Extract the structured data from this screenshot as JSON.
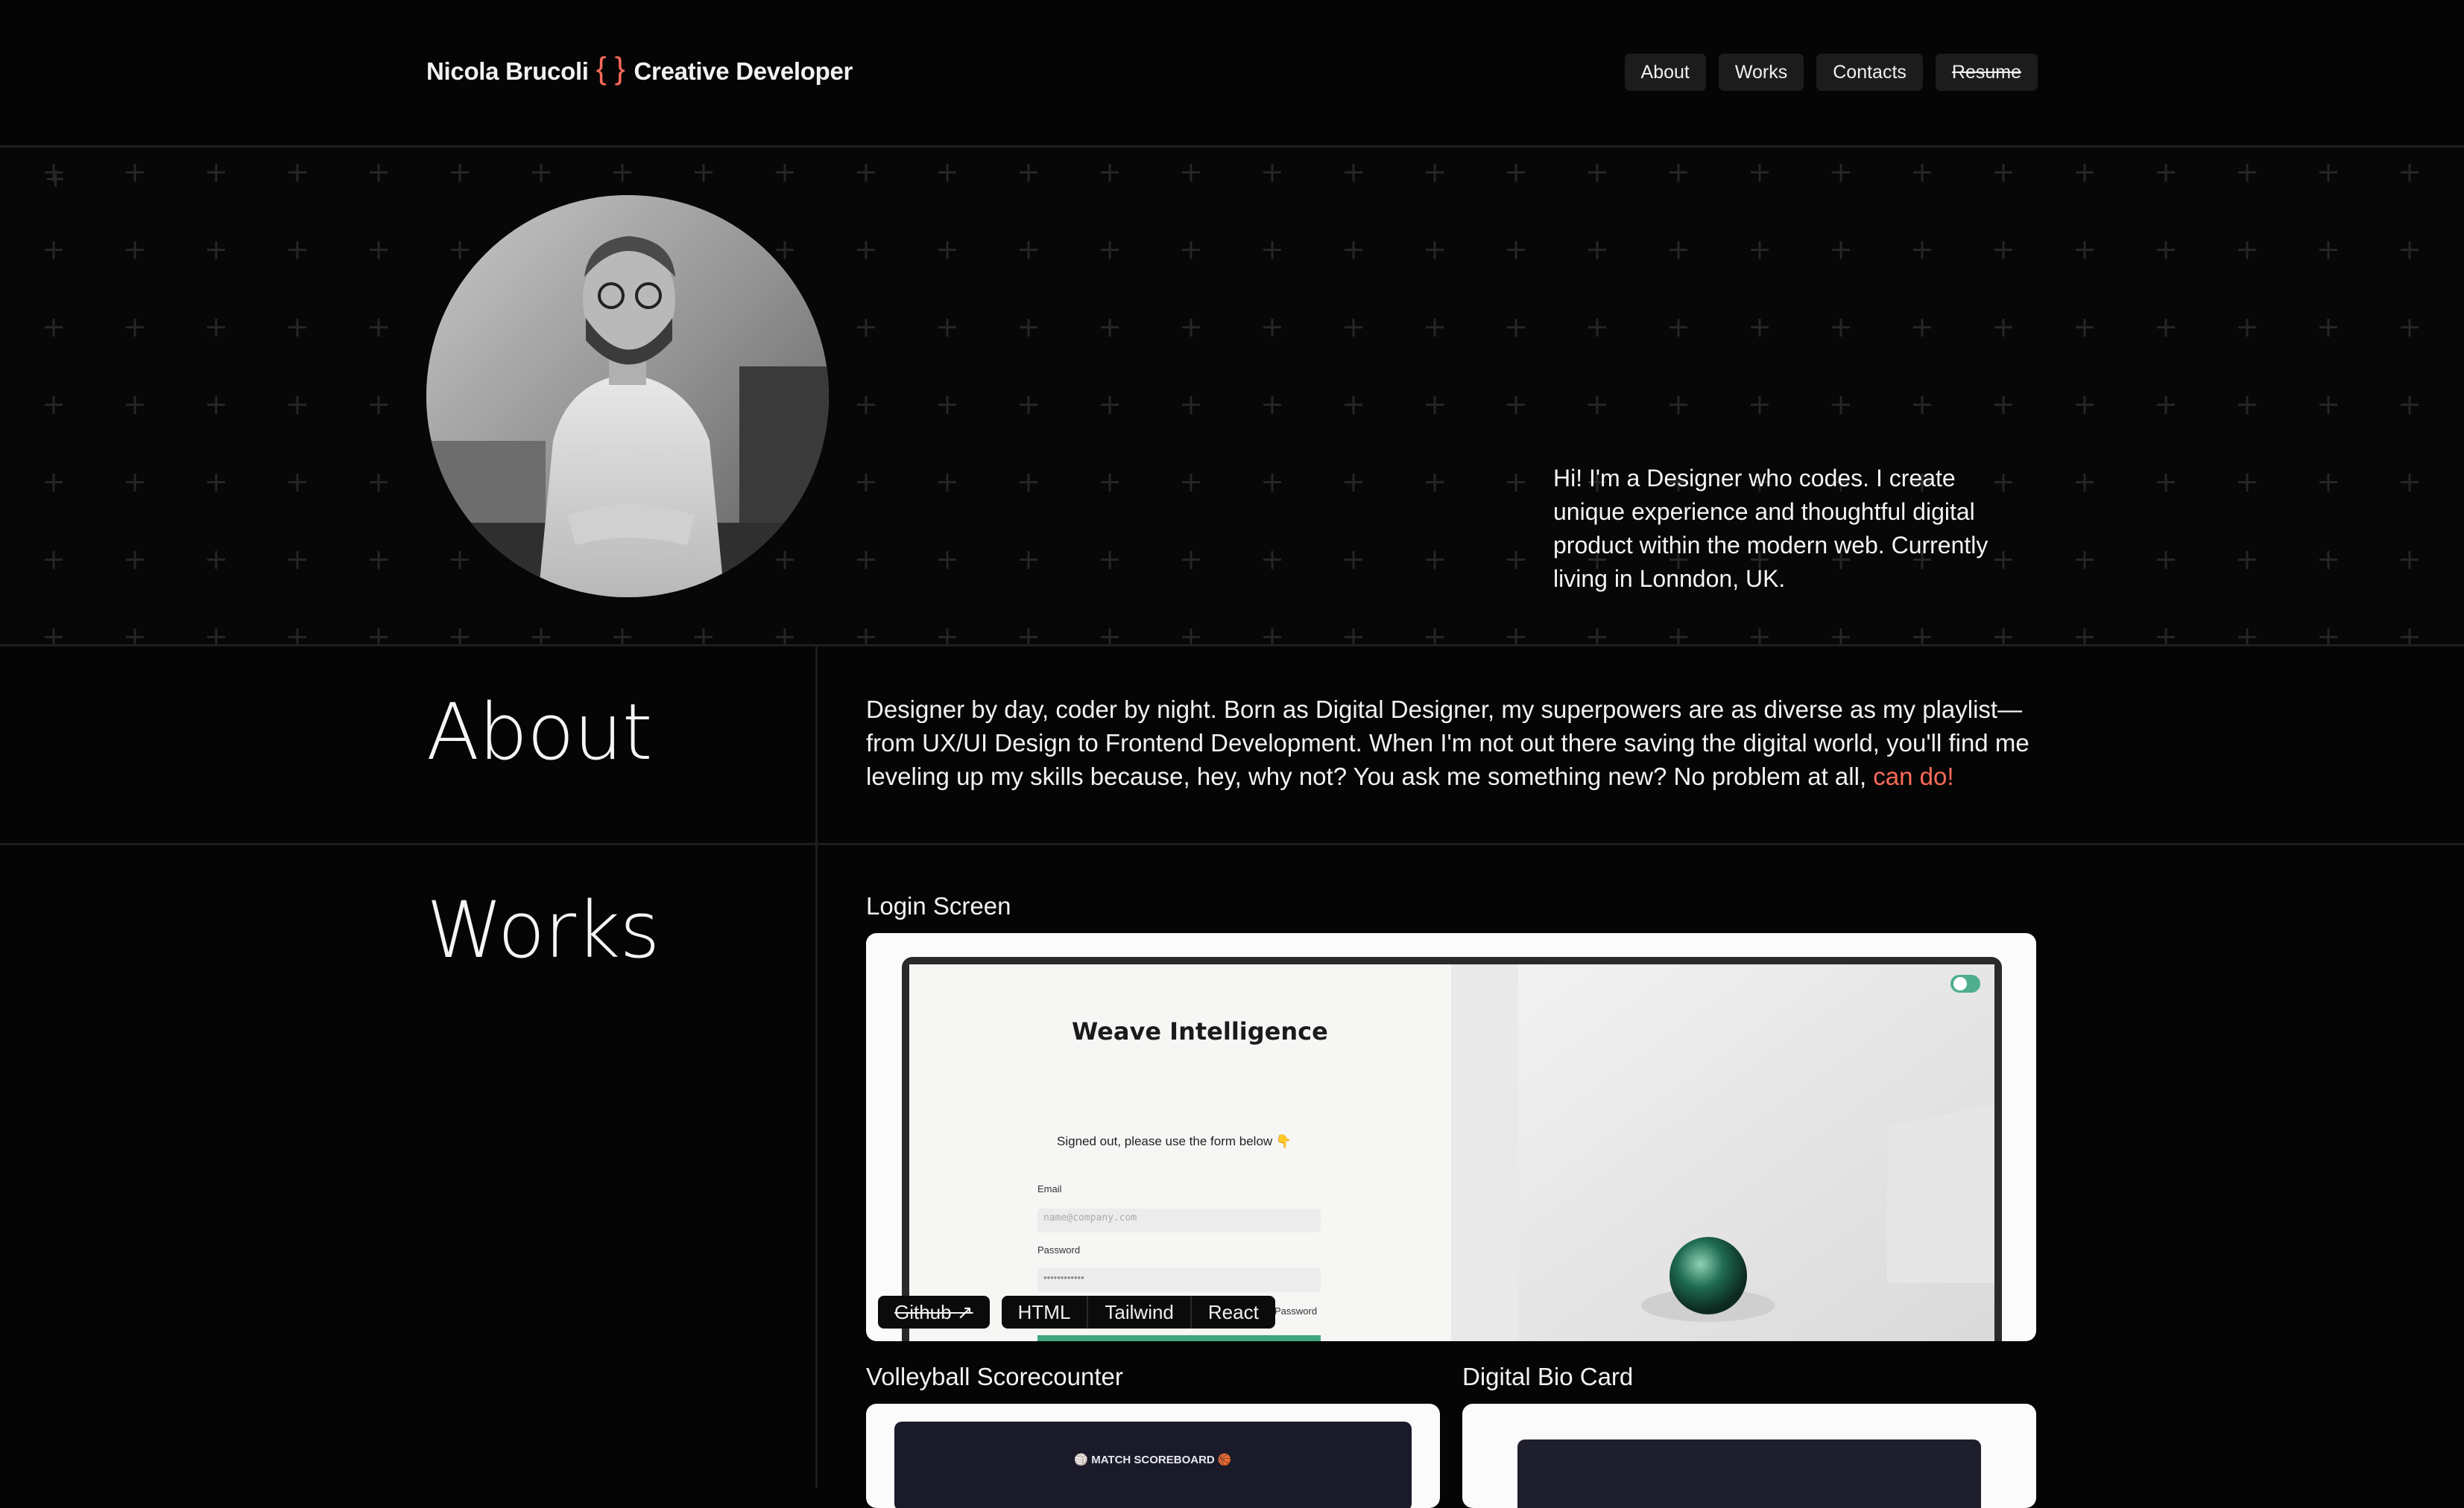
{
  "header": {
    "name": "Nicola Brucoli",
    "braces": "{ }",
    "role": "Creative Developer",
    "nav": [
      "About",
      "Works",
      "Contacts",
      "Resume"
    ]
  },
  "hero": {
    "intro": "Hi! I'm a Designer who codes. I create unique experience and thoughtful digital product within the modern web. Currently living in Lonndon, UK."
  },
  "about": {
    "title": "About",
    "text": "Designer by day, coder by night. Born as Digital Designer, my superpowers are as diverse as my playlist— from UX/UI Design to Frontend Development. When I'm not out there saving the digital world, you'll find me leveling up my skills because, hey, why not? You ask me something new? No problem at all,",
    "accent": "can do!"
  },
  "works": {
    "title": "Works",
    "projects": [
      {
        "title": "Login Screen",
        "preview": {
          "brand": "Weave Intelligence",
          "message": "Signed out, please use the form below 👇",
          "email_label": "Email",
          "email_placeholder": "name@company.com",
          "password_label": "Password",
          "password_value": "••••••••••••",
          "forgot": "Password"
        },
        "github": "Github ↗",
        "tags": [
          "HTML",
          "Tailwind",
          "React"
        ]
      },
      {
        "title": "Volleyball Scorecounter",
        "preview": {
          "header": "🏐 MATCH SCOREBOARD 🏀"
        }
      },
      {
        "title": "Digital Bio Card"
      }
    ]
  },
  "colors": {
    "accent": "#ff6b5a",
    "background": "#050505"
  }
}
